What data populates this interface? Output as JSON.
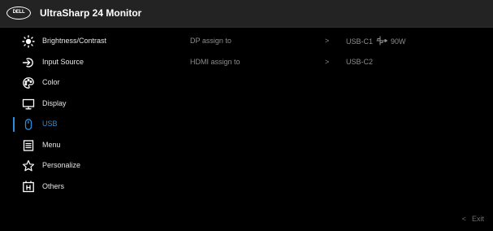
{
  "header": {
    "logo": "DELL",
    "title": "UltraSharp 24 Monitor"
  },
  "menu": [
    {
      "label": "Brightness/Contrast",
      "icon": "brightness-icon"
    },
    {
      "label": "Input Source",
      "icon": "input-source-icon"
    },
    {
      "label": "Color",
      "icon": "color-palette-icon"
    },
    {
      "label": "Display",
      "icon": "display-icon"
    },
    {
      "label": "USB",
      "icon": "mouse-icon",
      "active": true
    },
    {
      "label": "Menu",
      "icon": "menu-icon"
    },
    {
      "label": "Personalize",
      "icon": "star-icon"
    },
    {
      "label": "Others",
      "icon": "others-icon"
    }
  ],
  "options": [
    {
      "label": "DP assign to",
      "chevron": ">",
      "value": "USB-C1",
      "extra": "90W"
    },
    {
      "label": "HDMI assign to",
      "chevron": ">",
      "value": "USB-C2"
    }
  ],
  "footer": {
    "exit_chevron": "<",
    "exit_label": "Exit"
  },
  "colors": {
    "accent": "#2a8ee0",
    "header_bg": "#232323",
    "text_dim": "#8c8c8c"
  }
}
